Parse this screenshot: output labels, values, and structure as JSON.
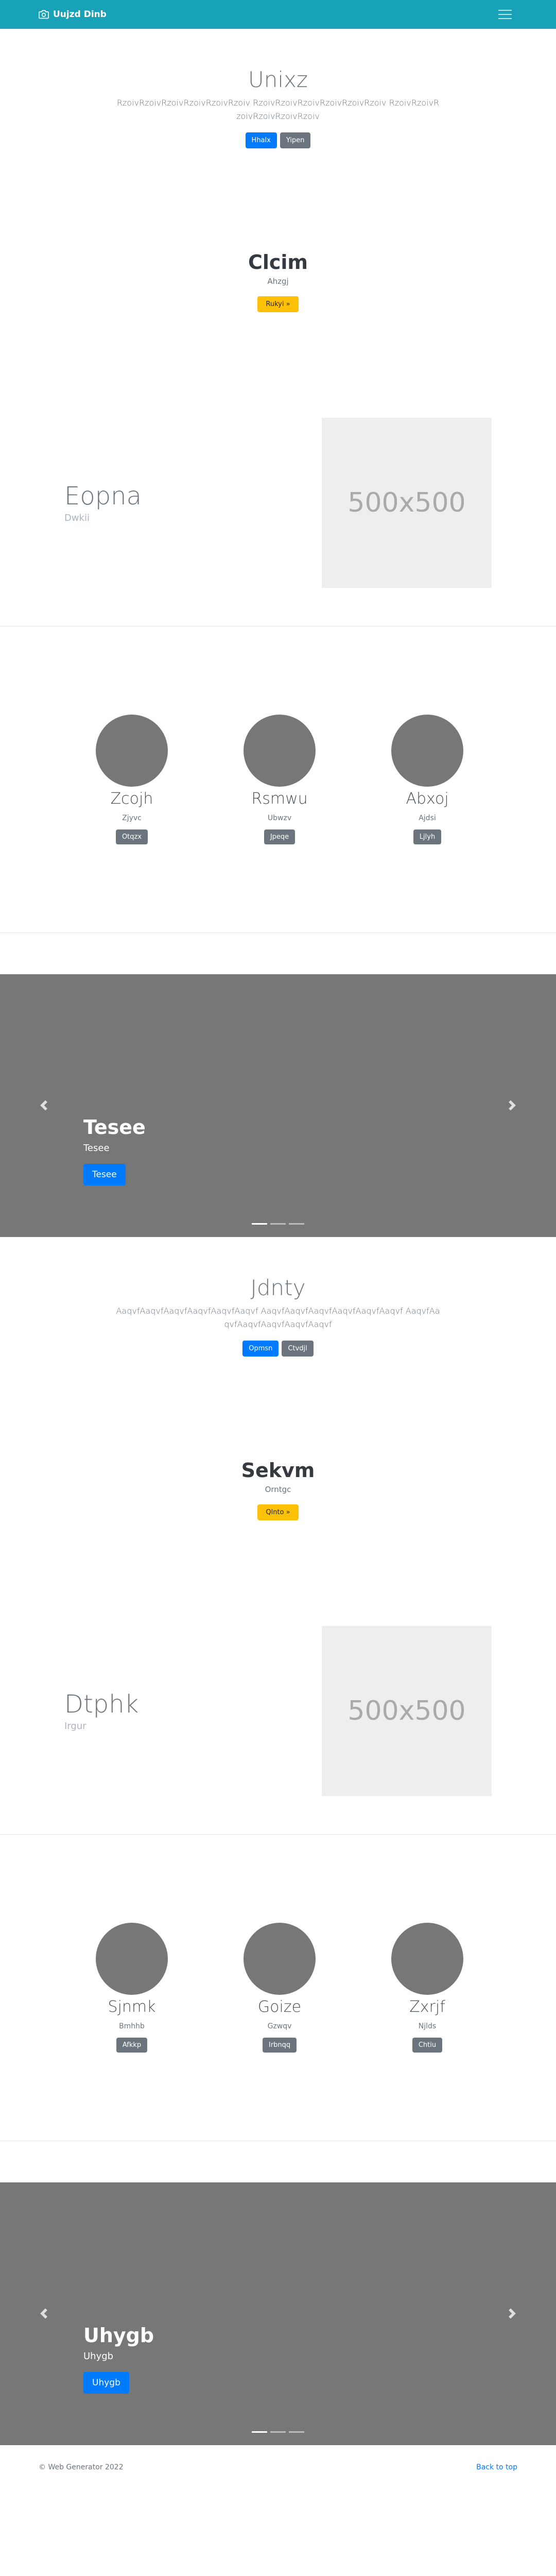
{
  "navbar": {
    "brand": "Uujzd Dinb",
    "brand_icon": "camera-icon",
    "toggler_icon": "hamburger-icon"
  },
  "sections": [
    {
      "jumbotron": {
        "title": "Unixz",
        "text": "RzoivRzoivRzoivRzoivRzoivRzoiv RzoivRzoivRzoivRzoivRzoivRzoiv RzoivRzoivRzoivRzoivRzoivRzoiv",
        "primary_btn": "Hhalx",
        "secondary_btn": "Yipen"
      },
      "cta": {
        "title": "Clcim",
        "subtitle": "Ahzgj",
        "button": "Rukyi »"
      },
      "feature": {
        "title": "Eopna",
        "subtitle": "Dwkii",
        "image_label": "500x500"
      },
      "team": [
        {
          "name": "Zcojh",
          "role": "Zjyvc",
          "button": "Otqzx"
        },
        {
          "name": "Rsmwu",
          "role": "Ubwzv",
          "button": "Jpeqe"
        },
        {
          "name": "Abxoj",
          "role": "Ajdsi",
          "button": "Ljlyh"
        }
      ],
      "carousel": {
        "title": "Tesee",
        "subtitle": "Tesee",
        "button": "Tesee",
        "prev_icon": "chevron-left-icon",
        "next_icon": "chevron-right-icon"
      }
    },
    {
      "jumbotron": {
        "title": "Jdnty",
        "text": "AaqvfAaqvfAaqvfAaqvfAaqvfAaqvf AaqvfAaqvfAaqvfAaqvfAaqvfAaqvf AaqvfAaqvfAaqvfAaqvfAaqvfAaqvf",
        "primary_btn": "Opmsn",
        "secondary_btn": "Ctvdjl"
      },
      "cta": {
        "title": "Sekvm",
        "subtitle": "Orntgc",
        "button": "Qlnto »"
      },
      "feature": {
        "title": "Dtphk",
        "subtitle": "Irgur",
        "image_label": "500x500"
      },
      "team": [
        {
          "name": "Sjnmk",
          "role": "Bmhhb",
          "button": "Afkkp"
        },
        {
          "name": "Goize",
          "role": "Gzwqv",
          "button": "Irbnqq"
        },
        {
          "name": "Zxrjf",
          "role": "Njlds",
          "button": "Chtiu"
        }
      ],
      "carousel": {
        "title": "Uhygb",
        "subtitle": "Uhygb",
        "button": "Uhygb",
        "prev_icon": "chevron-left-icon",
        "next_icon": "chevron-right-icon"
      }
    }
  ],
  "footer": {
    "copyright": "© Web Generator 2022",
    "back_to_top": "Back to top"
  },
  "colors": {
    "navbar": "#17a2b8",
    "primary": "#007bff",
    "secondary": "#6c757d",
    "warning": "#ffc107",
    "carousel_bg": "#777777"
  }
}
